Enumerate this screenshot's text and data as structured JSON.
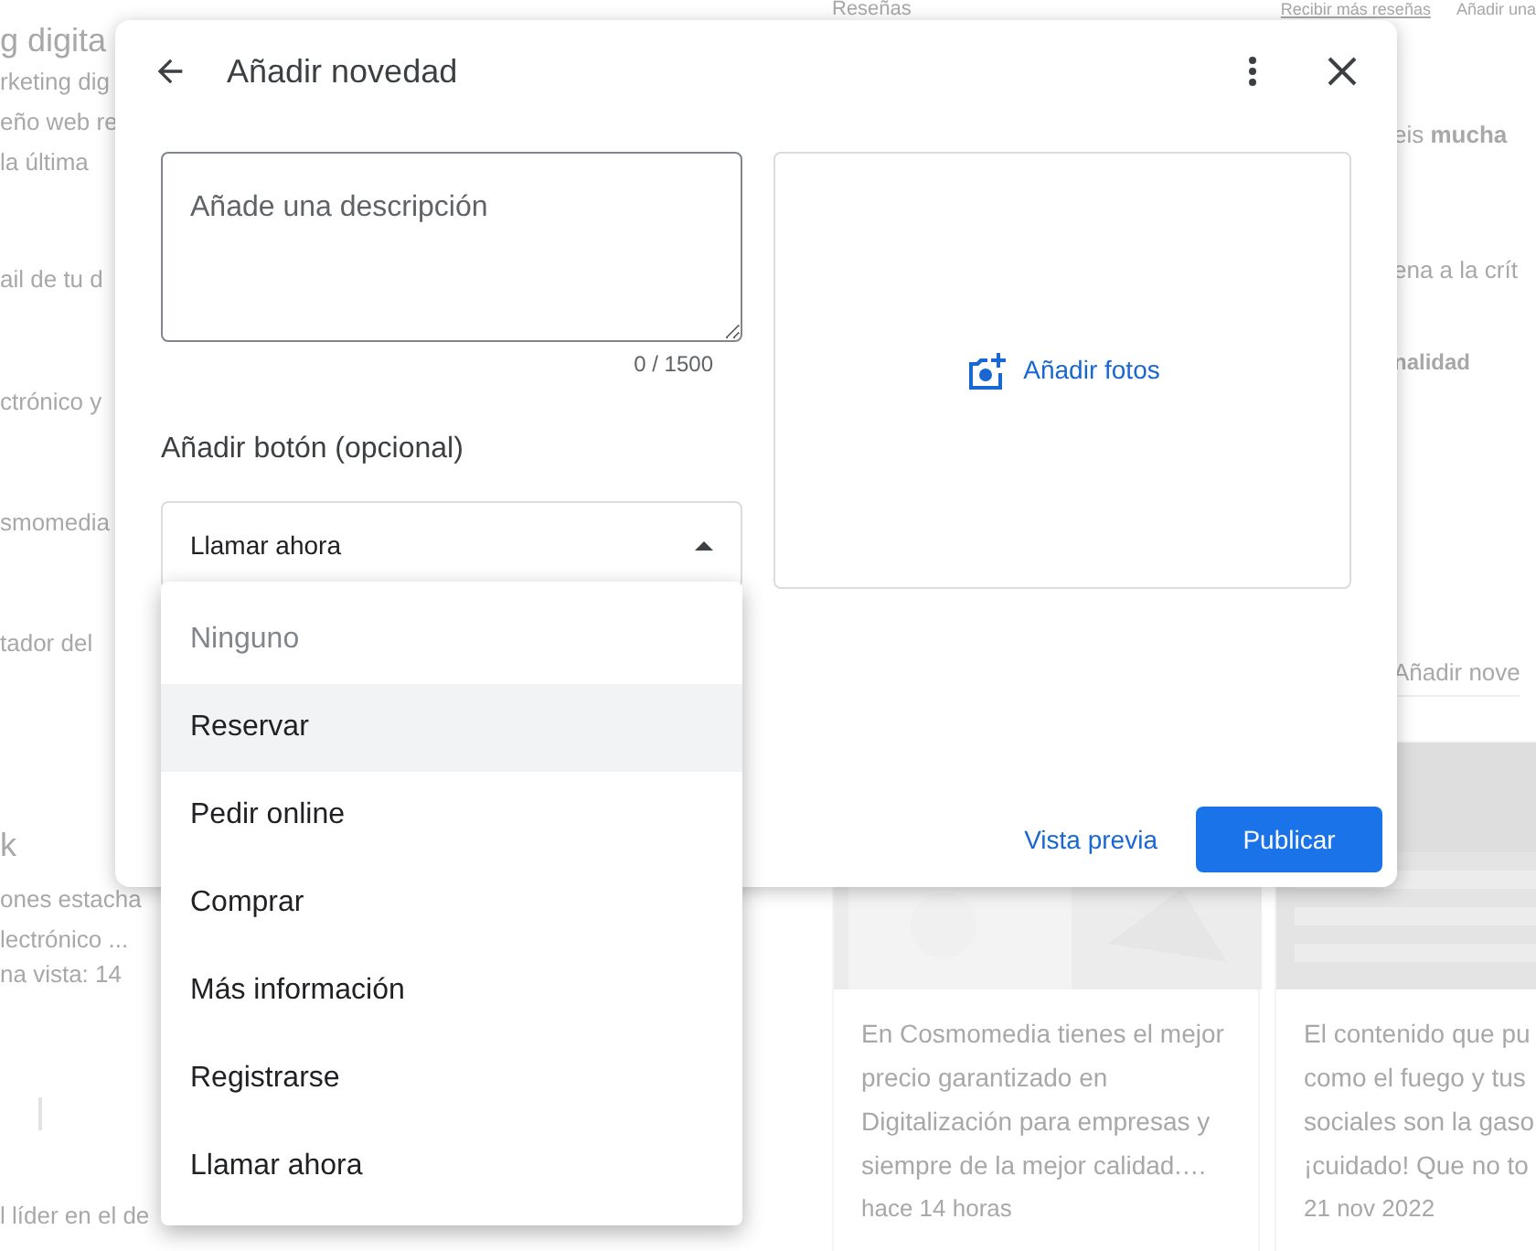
{
  "background": {
    "left_fragments": [
      {
        "kind": "heading",
        "text": "g digita"
      },
      {
        "kind": "text",
        "text": "rketing dig"
      },
      {
        "kind": "text",
        "text": "eño web re"
      },
      {
        "kind": "text",
        "text": "la última"
      },
      {
        "kind": "text",
        "text": "ail de tu d"
      },
      {
        "kind": "text",
        "text": "ctrónico y"
      },
      {
        "kind": "text",
        "text": "smomedia"
      },
      {
        "kind": "text",
        "text": "tador del"
      },
      {
        "kind": "heading",
        "text": "k"
      },
      {
        "kind": "text",
        "text": "ones estacha"
      },
      {
        "kind": "text",
        "text": "lectrónico ..."
      },
      {
        "kind": "text",
        "text": "na vista: 14"
      },
      {
        "kind": "icon"
      },
      {
        "kind": "text",
        "text": "l líder en el de"
      }
    ],
    "reviews_title": "Reseñas",
    "reviews_links": [
      "Recibir más reseñas",
      "Añadir una"
    ],
    "right_fragments": [
      {
        "kind": "text",
        "text": "eis **mucha**"
      },
      {
        "kind": "text",
        "text": "ena a la crít"
      },
      {
        "kind": "bold",
        "text": "nalidad"
      },
      {
        "kind": "link",
        "text": "Añadir nove"
      }
    ],
    "cards": [
      {
        "lines": [
          "En Cosmomedia tienes el mejor",
          "precio garantizado en",
          "Digitalización para empresas y",
          "siempre de la mejor calidad.…"
        ],
        "time": "hace 14 horas"
      },
      {
        "lines": [
          "El contenido que pu",
          "como el fuego y tus",
          "sociales son la gaso",
          "¡cuidado! Que no to"
        ],
        "time": "21 nov 2022"
      }
    ]
  },
  "dialog": {
    "title": "Añadir novedad",
    "description": {
      "placeholder": "Añade una descripción"
    },
    "counter": "0 / 1500",
    "button_label": "Añadir botón (opcional)",
    "select": {
      "value": "Llamar ahora",
      "expanded": true
    },
    "photos": "Añadir fotos",
    "preview": "Vista previa",
    "publish": "Publicar"
  },
  "menu": [
    {
      "label": "Ninguno",
      "disabled": true,
      "highlighted": false
    },
    {
      "label": "Reservar",
      "disabled": false,
      "highlighted": true
    },
    {
      "label": "Pedir online",
      "disabled": false,
      "highlighted": false
    },
    {
      "label": "Comprar",
      "disabled": false,
      "highlighted": false
    },
    {
      "label": "Más información",
      "disabled": false,
      "highlighted": false
    },
    {
      "label": "Registrarse",
      "disabled": false,
      "highlighted": false
    },
    {
      "label": "Llamar ahora",
      "disabled": false,
      "highlighted": false
    }
  ]
}
